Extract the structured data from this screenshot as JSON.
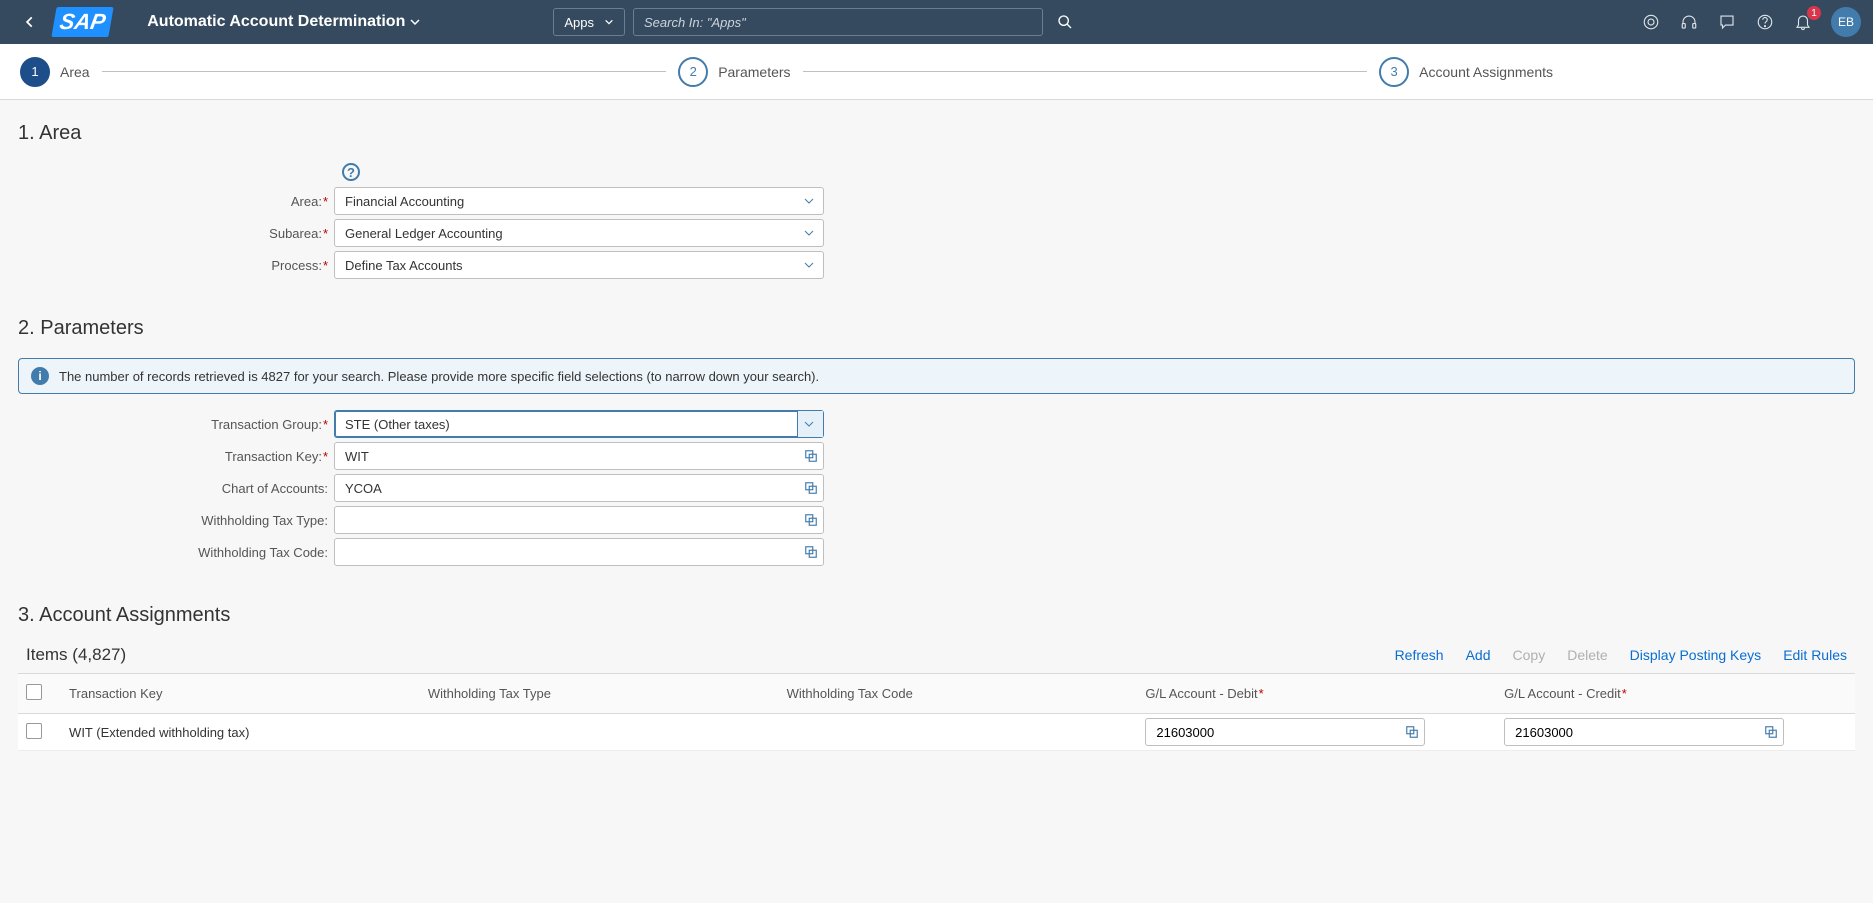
{
  "header": {
    "logo_text": "SAP",
    "title": "Automatic Account Determination",
    "apps_button": "Apps",
    "search_placeholder": "Search In: \"Apps\"",
    "notification_count": "1",
    "avatar_initials": "EB"
  },
  "steps": [
    {
      "num": "1",
      "label": "Area"
    },
    {
      "num": "2",
      "label": "Parameters"
    },
    {
      "num": "3",
      "label": "Account Assignments"
    }
  ],
  "sections": {
    "area_title": "1. Area",
    "parameters_title": "2. Parameters",
    "assignments_title": "3. Account Assignments"
  },
  "area_form": {
    "area_label": "Area:",
    "area_value": "Financial Accounting",
    "subarea_label": "Subarea:",
    "subarea_value": "General Ledger Accounting",
    "process_label": "Process:",
    "process_value": "Define Tax Accounts"
  },
  "info_message": "The number of records retrieved is 4827 for your search. Please provide more specific field selections (to narrow down your search).",
  "params_form": {
    "tgroup_label": "Transaction Group:",
    "tgroup_value": "STE (Other taxes)",
    "tkey_label": "Transaction Key:",
    "tkey_value": "WIT",
    "coa_label": "Chart of Accounts:",
    "coa_value": "YCOA",
    "wtt_label": "Withholding Tax Type:",
    "wtt_value": "",
    "wtc_label": "Withholding Tax Code:",
    "wtc_value": ""
  },
  "items": {
    "title": "Items (4,827)",
    "actions": {
      "refresh": "Refresh",
      "add": "Add",
      "copy": "Copy",
      "delete": "Delete",
      "display_posting_keys": "Display Posting Keys",
      "edit_rules": "Edit Rules"
    },
    "columns": {
      "tkey": "Transaction Key",
      "wtt": "Withholding Tax Type",
      "wtc": "Withholding Tax Code",
      "gldebit": "G/L Account - Debit",
      "glcredit": "G/L Account - Credit"
    },
    "rows": [
      {
        "tkey": "WIT (Extended withholding tax)",
        "wtt": "",
        "wtc": "",
        "gldebit": "21603000",
        "glcredit": "21603000"
      }
    ]
  }
}
